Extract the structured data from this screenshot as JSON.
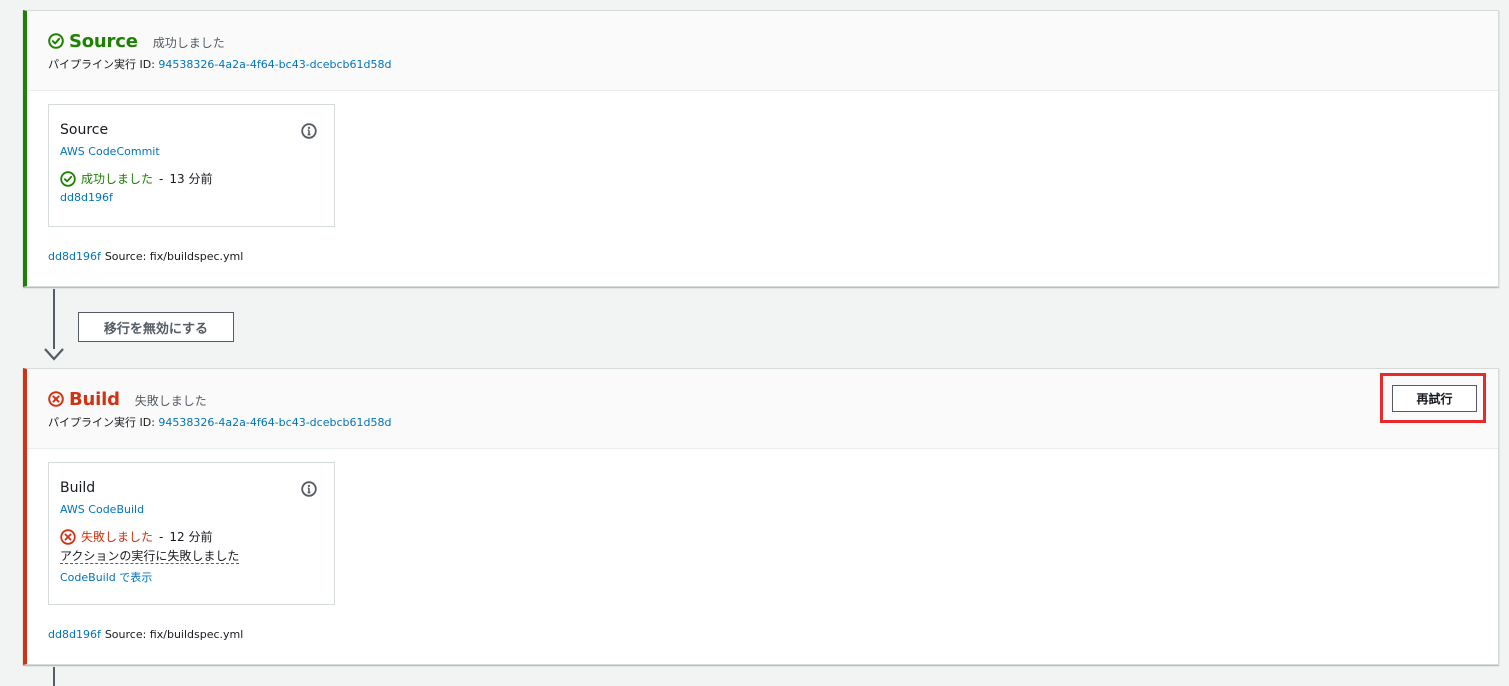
{
  "stages": {
    "source": {
      "name": "Source",
      "status": "成功しました",
      "exec_prefix": "パイプライン実行 ID:",
      "exec_id": "94538326-4a2a-4f64-bc43-dcebcb61d58d",
      "action": {
        "title": "Source",
        "provider": "AWS CodeCommit",
        "status": "成功しました",
        "separator": "-",
        "ago": "13 分前",
        "commit": "dd8d196f"
      },
      "footer": {
        "commit": "dd8d196f",
        "message": "Source: fix/buildspec.yml"
      }
    },
    "build": {
      "name": "Build",
      "status": "失敗しました",
      "exec_prefix": "パイプライン実行 ID:",
      "exec_id": "94538326-4a2a-4f64-bc43-dcebcb61d58d",
      "retry_label": "再試行",
      "action": {
        "title": "Build",
        "provider": "AWS CodeBuild",
        "status": "失敗しました",
        "separator": "-",
        "ago": "12 分前",
        "fail_message": "アクションの実行に失敗しました",
        "view_link": "CodeBuild で表示"
      },
      "footer": {
        "commit": "dd8d196f",
        "message": "Source: fix/buildspec.yml"
      }
    }
  },
  "transition": {
    "disable_label": "移行を無効にする"
  },
  "colors": {
    "success": "#1d8102",
    "error": "#d13212",
    "link": "#0073bb",
    "highlight": "#e52b2b"
  },
  "icons": {
    "success": "check-circle-icon",
    "error": "x-circle-icon",
    "info": "info-icon",
    "arrow": "arrow-down-icon"
  }
}
